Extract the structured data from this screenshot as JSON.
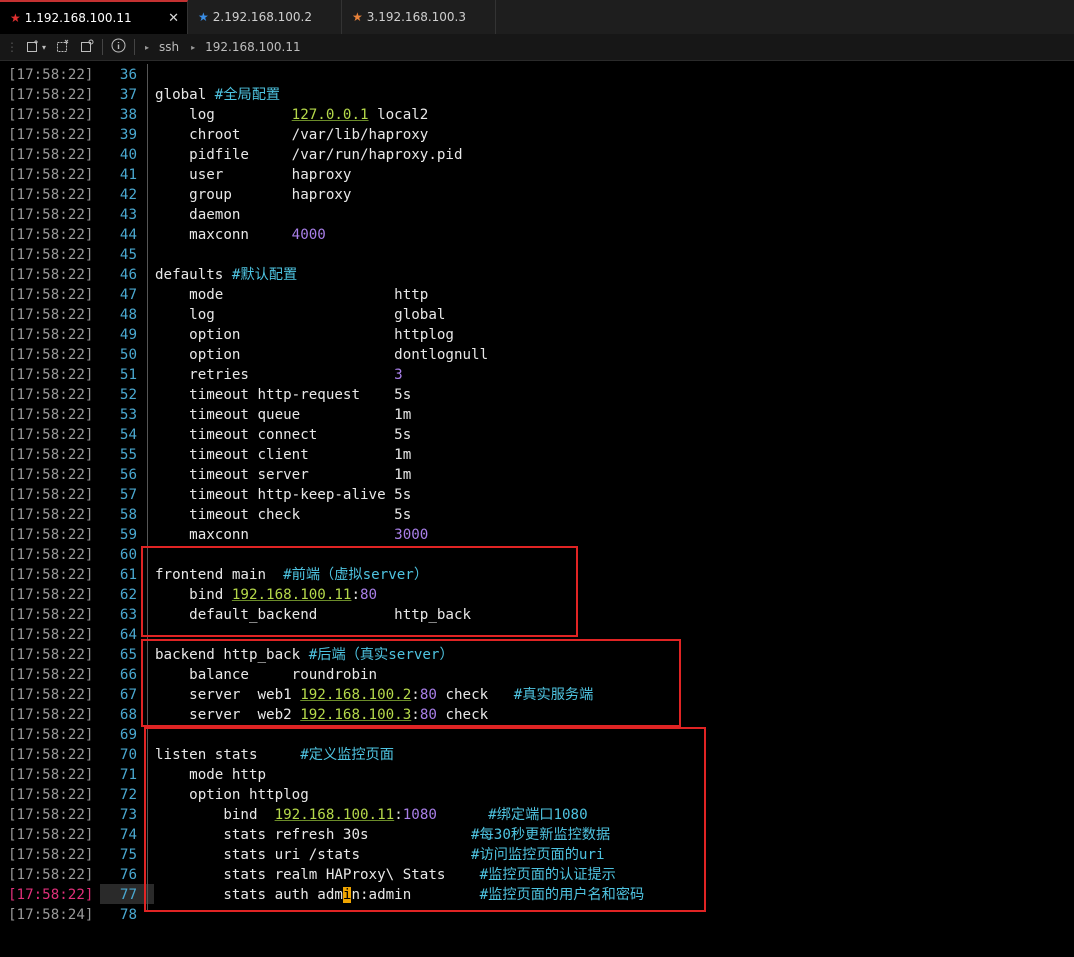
{
  "tabs": [
    {
      "label": "1.192.168.100.11",
      "star_color": "#e03030",
      "active": true
    },
    {
      "label": "2.192.168.100.2",
      "star_color": "#3a8ee6",
      "active": false
    },
    {
      "label": "3.192.168.100.3",
      "star_color": "#e8823a",
      "active": false
    }
  ],
  "toolbar": {
    "crumb1": "ssh",
    "crumb2": "192.168.100.11"
  },
  "lines": [
    {
      "ts": "[17:58:22]",
      "n": "36",
      "html": ""
    },
    {
      "ts": "[17:58:22]",
      "n": "37",
      "html": "global <span class=\"cmt\">#全局配置</span>"
    },
    {
      "ts": "[17:58:22]",
      "n": "38",
      "html": "    log         <span class=\"ip\">127.0.0.1</span> local2"
    },
    {
      "ts": "[17:58:22]",
      "n": "39",
      "html": "    chroot      /var/lib/haproxy"
    },
    {
      "ts": "[17:58:22]",
      "n": "40",
      "html": "    pidfile     /var/run/haproxy.pid"
    },
    {
      "ts": "[17:58:22]",
      "n": "41",
      "html": "    user        haproxy"
    },
    {
      "ts": "[17:58:22]",
      "n": "42",
      "html": "    group       haproxy"
    },
    {
      "ts": "[17:58:22]",
      "n": "43",
      "html": "    daemon"
    },
    {
      "ts": "[17:58:22]",
      "n": "44",
      "html": "    maxconn     <span class=\"num\">4000</span>"
    },
    {
      "ts": "[17:58:22]",
      "n": "45",
      "html": ""
    },
    {
      "ts": "[17:58:22]",
      "n": "46",
      "html": "defaults <span class=\"cmt\">#默认配置</span>"
    },
    {
      "ts": "[17:58:22]",
      "n": "47",
      "html": "    mode                    http"
    },
    {
      "ts": "[17:58:22]",
      "n": "48",
      "html": "    log                     global"
    },
    {
      "ts": "[17:58:22]",
      "n": "49",
      "html": "    option                  httplog"
    },
    {
      "ts": "[17:58:22]",
      "n": "50",
      "html": "    option                  dontlognull"
    },
    {
      "ts": "[17:58:22]",
      "n": "51",
      "html": "    retries                 <span class=\"num\">3</span>"
    },
    {
      "ts": "[17:58:22]",
      "n": "52",
      "html": "    timeout http-request    5s"
    },
    {
      "ts": "[17:58:22]",
      "n": "53",
      "html": "    timeout queue           1m"
    },
    {
      "ts": "[17:58:22]",
      "n": "54",
      "html": "    timeout connect         5s"
    },
    {
      "ts": "[17:58:22]",
      "n": "55",
      "html": "    timeout client          1m"
    },
    {
      "ts": "[17:58:22]",
      "n": "56",
      "html": "    timeout server          1m"
    },
    {
      "ts": "[17:58:22]",
      "n": "57",
      "html": "    timeout http-keep-alive 5s"
    },
    {
      "ts": "[17:58:22]",
      "n": "58",
      "html": "    timeout check           5s"
    },
    {
      "ts": "[17:58:22]",
      "n": "59",
      "html": "    maxconn                 <span class=\"num\">3000</span>"
    },
    {
      "ts": "[17:58:22]",
      "n": "60",
      "html": ""
    },
    {
      "ts": "[17:58:22]",
      "n": "61",
      "html": "frontend main  <span class=\"cmt\">#前端（虚拟server）</span>"
    },
    {
      "ts": "[17:58:22]",
      "n": "62",
      "html": "    bind <span class=\"ip\">192.168.100.11</span>:<span class=\"port\">80</span>"
    },
    {
      "ts": "[17:58:22]",
      "n": "63",
      "html": "    default_backend         http_back"
    },
    {
      "ts": "[17:58:22]",
      "n": "64",
      "html": ""
    },
    {
      "ts": "[17:58:22]",
      "n": "65",
      "html": "backend http_back <span class=\"cmt\">#后端（真实server）</span>"
    },
    {
      "ts": "[17:58:22]",
      "n": "66",
      "html": "    balance     roundrobin"
    },
    {
      "ts": "[17:58:22]",
      "n": "67",
      "html": "    server  web1 <span class=\"ip\">192.168.100.2</span>:<span class=\"port\">80</span> check   <span class=\"cmt\">#真实服务端</span>"
    },
    {
      "ts": "[17:58:22]",
      "n": "68",
      "html": "    server  web2 <span class=\"ip\">192.168.100.3</span>:<span class=\"port\">80</span> check"
    },
    {
      "ts": "[17:58:22]",
      "n": "69",
      "html": ""
    },
    {
      "ts": "[17:58:22]",
      "n": "70",
      "html": "listen stats     <span class=\"cmt\">#定义监控页面</span>"
    },
    {
      "ts": "[17:58:22]",
      "n": "71",
      "html": "    mode http"
    },
    {
      "ts": "[17:58:22]",
      "n": "72",
      "html": "    option httplog"
    },
    {
      "ts": "[17:58:22]",
      "n": "73",
      "html": "        bind  <span class=\"ip\">192.168.100.11</span>:<span class=\"port\">1080</span>      <span class=\"cmt\">#绑定端口1080</span>"
    },
    {
      "ts": "[17:58:22]",
      "n": "74",
      "html": "        stats refresh 30s            <span class=\"cmt\">#每30秒更新监控数据</span>"
    },
    {
      "ts": "[17:58:22]",
      "n": "75",
      "html": "        stats uri /stats             <span class=\"cmt\">#访问监控页面的uri</span>"
    },
    {
      "ts": "[17:58:22]",
      "n": "76",
      "html": "        stats realm HAProxy\\ Stats    <span class=\"cmt\">#监控页面的认证提示</span>"
    },
    {
      "ts": "[17:58:22]",
      "n": "77",
      "html": "        stats auth adm<span class=\"cursor\">i</span>n:admin        <span class=\"cmt\">#监控页面的用户名和密码</span>",
      "ts_color": "#e0307a"
    },
    {
      "ts": "[17:58:24]",
      "n": "78",
      "html": ""
    }
  ]
}
